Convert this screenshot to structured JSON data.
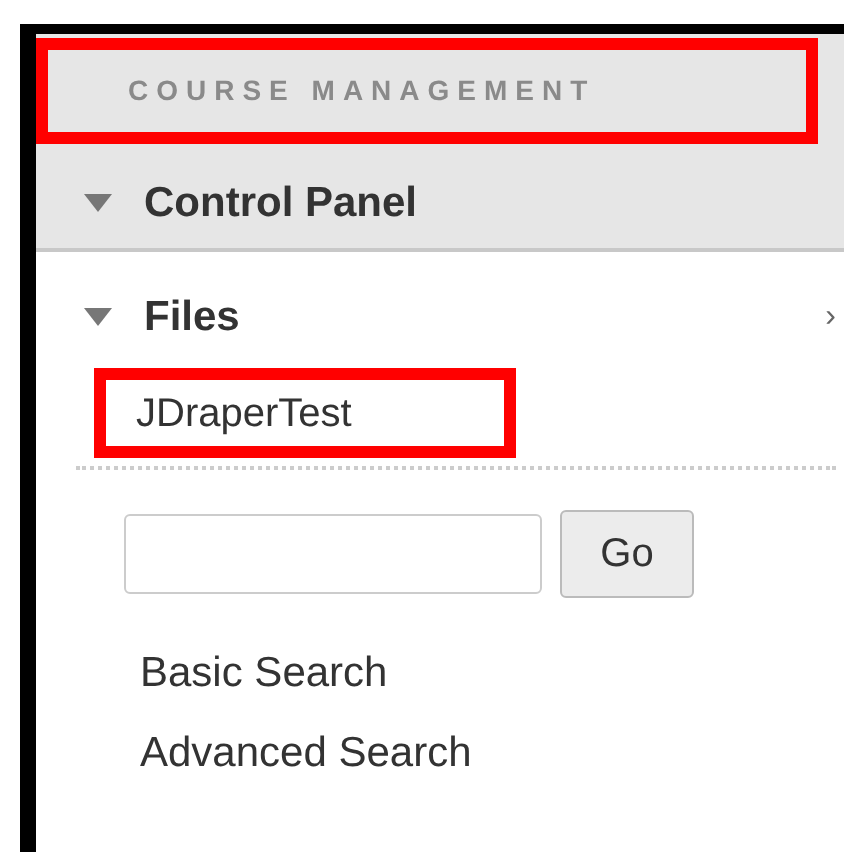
{
  "header": {
    "title": "COURSE MANAGEMENT",
    "highlighted": true
  },
  "sections": [
    {
      "label": "Control Panel",
      "expanded": true,
      "kind": "panel"
    },
    {
      "label": "Files",
      "expanded": true,
      "kind": "files",
      "arrow": "›",
      "children": [
        {
          "label": "JDraperTest",
          "highlighted": true
        }
      ]
    }
  ],
  "search": {
    "button": "Go",
    "links": [
      "Basic Search",
      "Advanced Search"
    ]
  }
}
